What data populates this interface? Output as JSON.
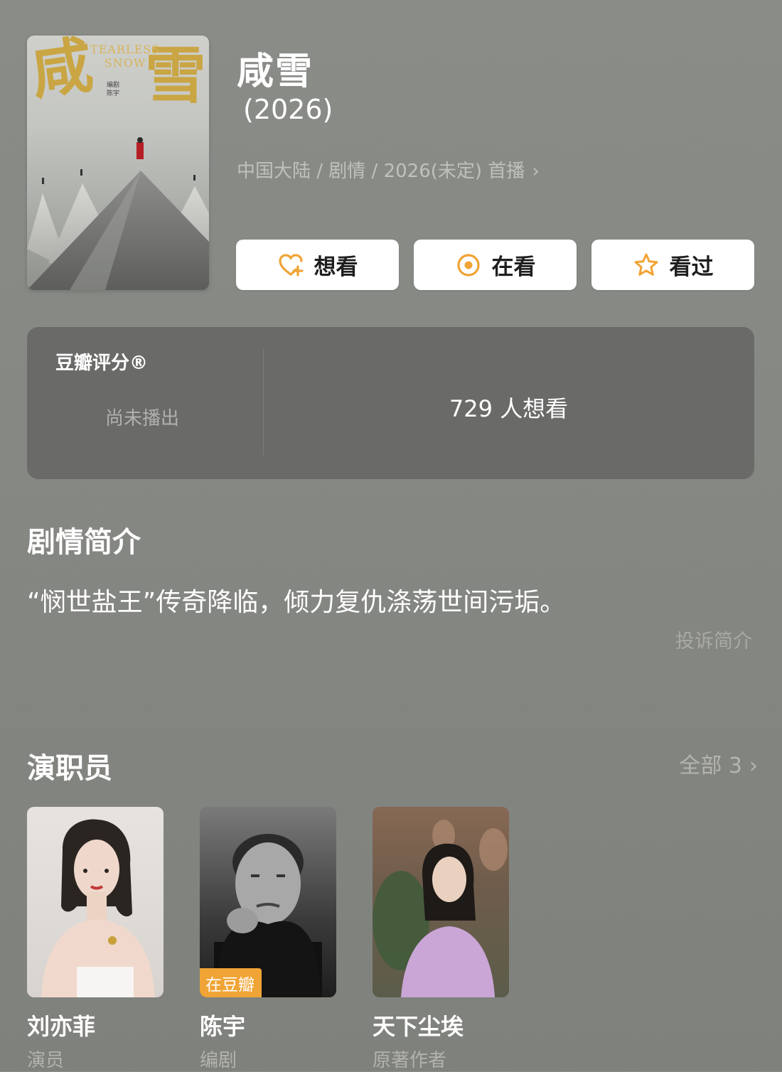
{
  "movie": {
    "title": "咸雪",
    "year": "(2026)",
    "meta": "中国大陆 / 剧情 / 2026(未定) 首播",
    "poster": {
      "big_chars": [
        "咸",
        "雪"
      ],
      "english_title": "TEARLESS SNOW",
      "credit": "编剧\n陈宇"
    }
  },
  "actions": {
    "want_label": "想看",
    "watching_label": "在看",
    "watched_label": "看过",
    "icons": [
      "heart-plus-icon",
      "target-icon",
      "star-icon"
    ],
    "accent_color": "#f0a435"
  },
  "rating": {
    "label": "豆瓣评分®",
    "status": "尚未播出",
    "want_count_text": "729 人想看"
  },
  "plot": {
    "section_title": "剧情简介",
    "text": "“悯世盐王”传奇降临，倾力复仇涤荡世间污垢。",
    "report_label": "投诉简介"
  },
  "cast": {
    "section_title": "演职员",
    "all_label": "全部 3",
    "members": [
      {
        "name": "刘亦菲",
        "role": "演员",
        "badge": ""
      },
      {
        "name": "陈宇",
        "role": "编剧",
        "badge": "在豆瓣"
      },
      {
        "name": "天下尘埃",
        "role": "原著作者",
        "badge": ""
      }
    ]
  }
}
